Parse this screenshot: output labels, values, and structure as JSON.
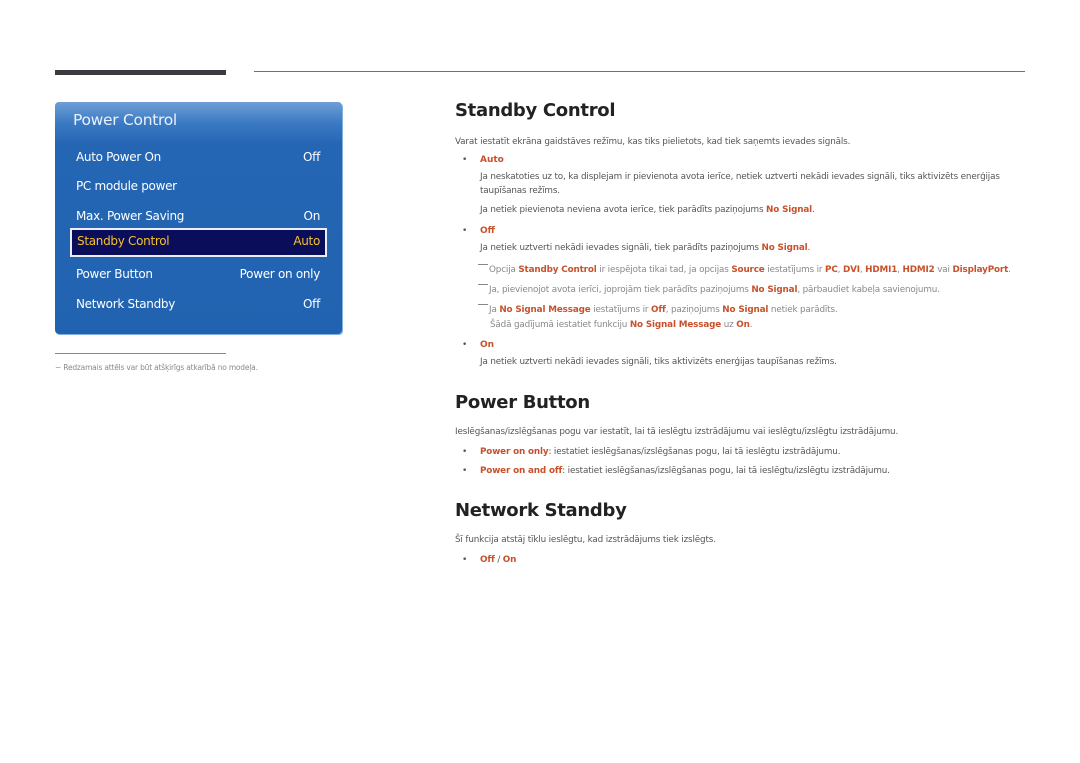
{
  "osd": {
    "title": "Power Control",
    "items": [
      {
        "label": "Auto Power On",
        "value": "Off"
      },
      {
        "label": "PC module power",
        "value": ""
      },
      {
        "label": "Max. Power Saving",
        "value": "On"
      },
      {
        "label": "Standby Control",
        "value": "Auto",
        "selected": true
      },
      {
        "label": "Power Button",
        "value": "Power on only"
      },
      {
        "label": "Network Standby",
        "value": "Off"
      }
    ]
  },
  "footnote": "Redzamais attēls var būt atšķirīgs atkarībā no modeļa.",
  "standby": {
    "title": "Standby Control",
    "intro": "Varat iestatīt ekrāna gaidstāves režīmu, kas tiks pielietots, kad tiek saņemts ievades signāls.",
    "auto": {
      "label": "Auto",
      "line1": "Ja neskatoties uz to, ka displejam ir pievienota avota ierīce, netiek uztverti nekādi ievades signāli, tiks aktivizēts enerģijas",
      "line2": "taupīšanas režīms.",
      "line3_pre": "Ja netiek pievienota neviena avota ierīce, tiek parādīts paziņojums ",
      "line3_hl": "No Signal",
      "line3_post": "."
    },
    "off": {
      "label": "Off",
      "text_pre": "Ja netiek uztverti nekādi ievades signāli, tiek parādīts paziņojums ",
      "text_hl": "No Signal",
      "text_post": "."
    },
    "notes": {
      "n1": {
        "t1": "Opcija ",
        "h1": "Standby Control",
        "t2": " ir iespējota tikai tad, ja opcijas ",
        "h2": "Source",
        "t3": " iestatījums ir ",
        "h3": "PC",
        "t4": ", ",
        "h4": "DVI",
        "t5": ", ",
        "h5": "HDMI1",
        "t6": ", ",
        "h6": "HDMI2",
        "t7": " vai ",
        "h7": "DisplayPort",
        "t8": "."
      },
      "n2": {
        "t1": "Ja, pievienojot avota ierīci, joprojām tiek parādīts paziņojums ",
        "h1": "No Signal",
        "t2": ", pārbaudiet kabeļa savienojumu."
      },
      "n3": {
        "t1": "Ja ",
        "h1": "No Signal Message",
        "t2": " iestatījums ir ",
        "h2": "Off",
        "t3": ", paziņojums ",
        "h3": "No Signal",
        "t4": " netiek parādīts.",
        "t5": "Šādā gadījumā iestatiet funkciju ",
        "h4": "No Signal Message",
        "t6": " uz ",
        "h5": "On",
        "t7": "."
      }
    },
    "on": {
      "label": "On",
      "text": "Ja netiek uztverti nekādi ievades signāli, tiks aktivizēts enerģijas taupīšanas režīms."
    }
  },
  "power_button": {
    "title": "Power Button",
    "intro": "Ieslēgšanas/izslēgšanas pogu var iestatīt, lai tā ieslēgtu izstrādājumu vai ieslēgtu/izslēgtu izstrādājumu.",
    "options": [
      {
        "label": "Power on only",
        "text": ": iestatiet ieslēgšanas/izslēgšanas pogu, lai tā ieslēgtu izstrādājumu."
      },
      {
        "label": "Power on and off",
        "text": ": iestatiet ieslēgšanas/izslēgšanas pogu, lai tā ieslēgtu/izslēgtu izstrādājumu."
      }
    ]
  },
  "network_standby": {
    "title": "Network Standby",
    "intro": "Šī funkcija atstāj tīklu ieslēgtu, kad izstrādājums tiek izslēgts.",
    "opt_off": "Off",
    "sep": " / ",
    "opt_on": "On"
  },
  "bullet": "•",
  "colors": {
    "accent": "#c8502a",
    "osd_blue": "#2163b0",
    "osd_selected": "#0a0d5a",
    "osd_selected_text": "#f6c229"
  }
}
